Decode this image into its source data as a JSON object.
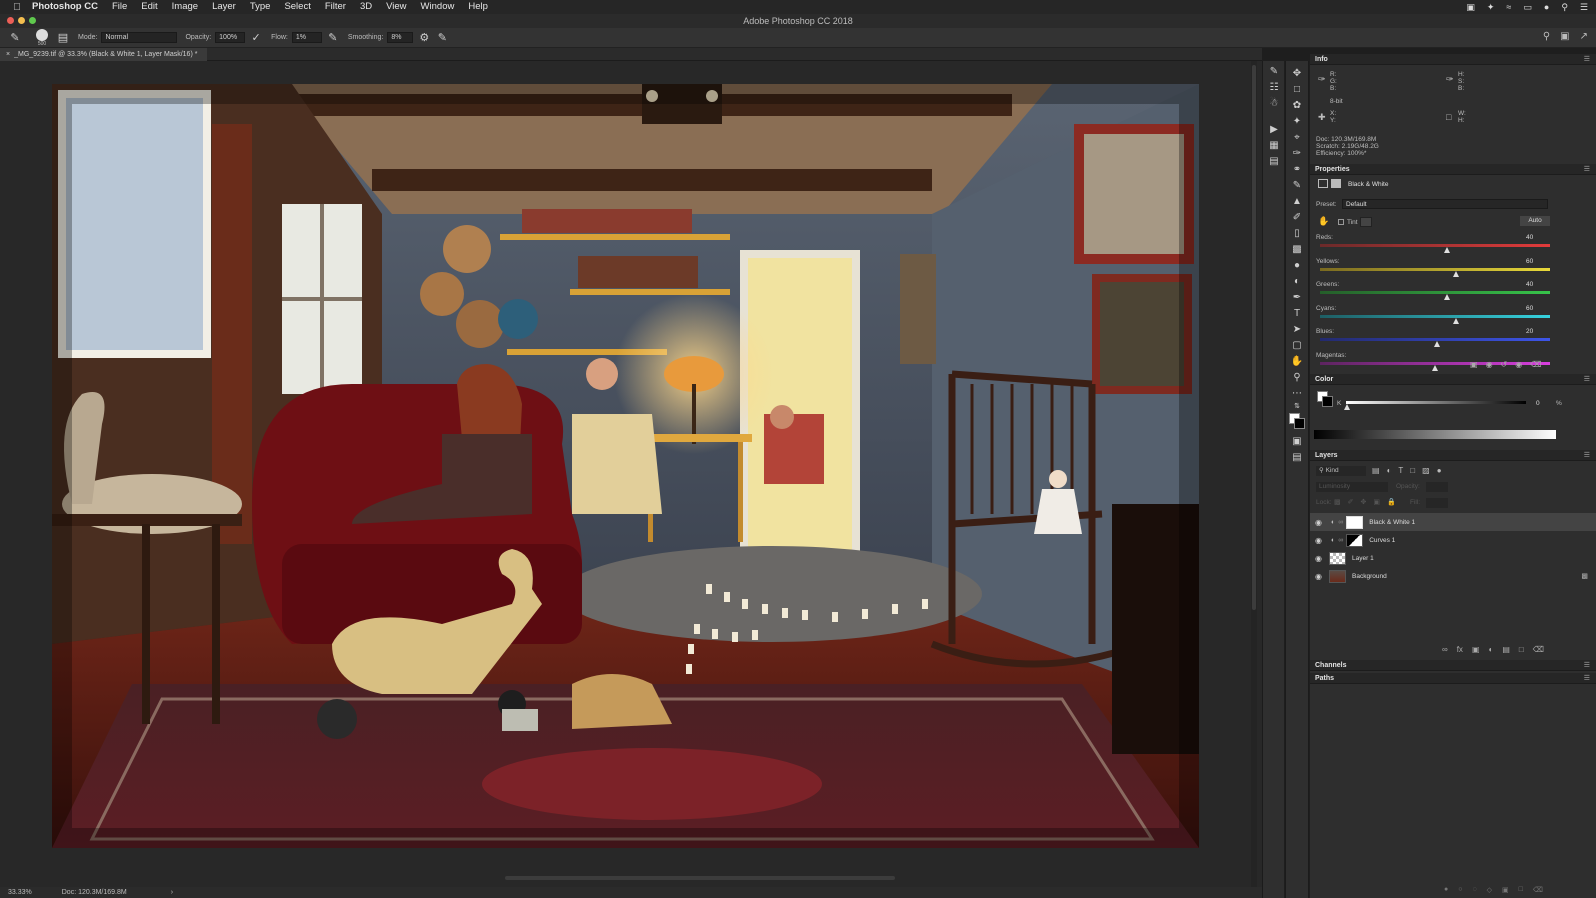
{
  "menubar": {
    "app": "Photoshop CC",
    "items": [
      "File",
      "Edit",
      "Image",
      "Layer",
      "Type",
      "Select",
      "Filter",
      "3D",
      "View",
      "Window",
      "Help"
    ]
  },
  "window": {
    "title": "Adobe Photoshop CC 2018"
  },
  "options": {
    "mode_label": "Mode:",
    "mode_value": "Normal",
    "opacity_label": "Opacity:",
    "opacity_value": "100%",
    "flow_label": "Flow:",
    "flow_value": "1%",
    "smoothing_label": "Smoothing:",
    "smoothing_value": "8%",
    "brush_size": "500"
  },
  "document": {
    "tab_label": "_MG_9239.tif @ 33.3% (Black & White 1, Layer Mask/16) *",
    "zoom": "33.33%",
    "doc_size": "Doc: 120.3M/169.8M"
  },
  "info_panel": {
    "title": "Info",
    "rgb": "R:\nG:\nB:",
    "hsb": "H:\nS:\nB:",
    "bit": "8-bit",
    "xy": "X:\nY:",
    "wh": "W:\nH:",
    "doc": "Doc: 120.3M/169.8M",
    "scratch": "Scratch: 2.19G/48.2G",
    "efficiency": "Efficiency: 100%*"
  },
  "properties_panel": {
    "title": "Properties",
    "adjustment": "Black & White",
    "preset_label": "Preset:",
    "preset_value": "Default",
    "tint_label": "Tint",
    "auto_label": "Auto",
    "sliders": [
      {
        "name": "Reds:",
        "value": "40",
        "level": 0.55,
        "gradient": "linear-gradient(90deg,#6b2a2a,#e23b3b)"
      },
      {
        "name": "Yellows:",
        "value": "60",
        "level": 0.59,
        "gradient": "linear-gradient(90deg,#7a6a20,#e8d93a)"
      },
      {
        "name": "Greens:",
        "value": "40",
        "level": 0.55,
        "gradient": "linear-gradient(90deg,#255e2a,#37c44a)"
      },
      {
        "name": "Cyans:",
        "value": "60",
        "level": 0.59,
        "gradient": "linear-gradient(90deg,#1e5e64,#36d2de)"
      },
      {
        "name": "Blues:",
        "value": "20",
        "level": 0.51,
        "gradient": "linear-gradient(90deg,#232a6e,#3d55e8)"
      },
      {
        "name": "Magentas:",
        "value": "",
        "level": 0.5,
        "gradient": "linear-gradient(90deg,#5d2460,#d83ede)"
      }
    ]
  },
  "color_panel": {
    "title": "Color",
    "k_label": "K",
    "k_value": "0",
    "k_unit": "%"
  },
  "layers_panel": {
    "title": "Layers",
    "kind_label": "Kind",
    "blend_mode": "Luminosity",
    "opacity_label": "Opacity:",
    "lock_label": "Lock:",
    "fill_label": "Fill:",
    "layers": [
      {
        "name": "Black & White 1",
        "selected": true
      },
      {
        "name": "Curves 1",
        "selected": false
      },
      {
        "name": "Layer 1",
        "selected": false
      },
      {
        "name": "Background",
        "selected": false
      }
    ]
  },
  "channels_label": "Channels",
  "paths_label": "Paths",
  "colors": {
    "accent": "#4a90e2",
    "panel_bg": "#2e2e2e",
    "canvas_bg": "#282828"
  }
}
